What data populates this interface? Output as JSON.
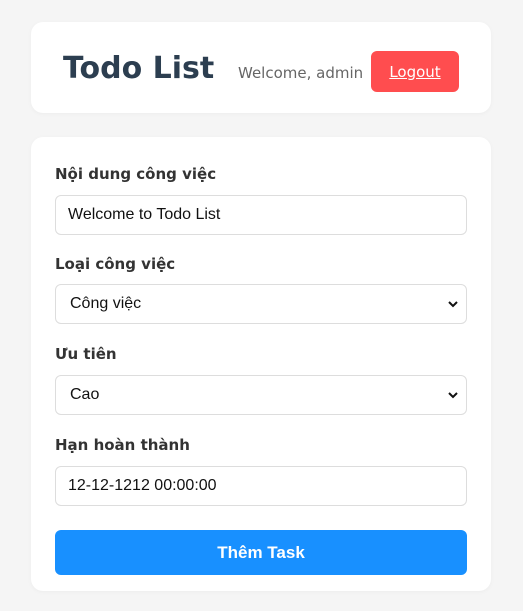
{
  "header": {
    "title": "Todo List",
    "welcome": "Welcome, admin",
    "logout_label": "Logout"
  },
  "form": {
    "content": {
      "label": "Nội dung công việc",
      "value": "Welcome to Todo List"
    },
    "category": {
      "label": "Loại công việc",
      "selected": "Công việc"
    },
    "priority": {
      "label": "Ưu tiên",
      "selected": "Cao"
    },
    "deadline": {
      "label": "Hạn hoàn thành",
      "value": "12-12-1212 00:00:00"
    },
    "submit_label": "Thêm Task"
  },
  "colors": {
    "accent_blue": "#1890ff",
    "logout_red": "#ff4d4f",
    "title_dark": "#2c3e50",
    "background": "#f5f5f5"
  }
}
